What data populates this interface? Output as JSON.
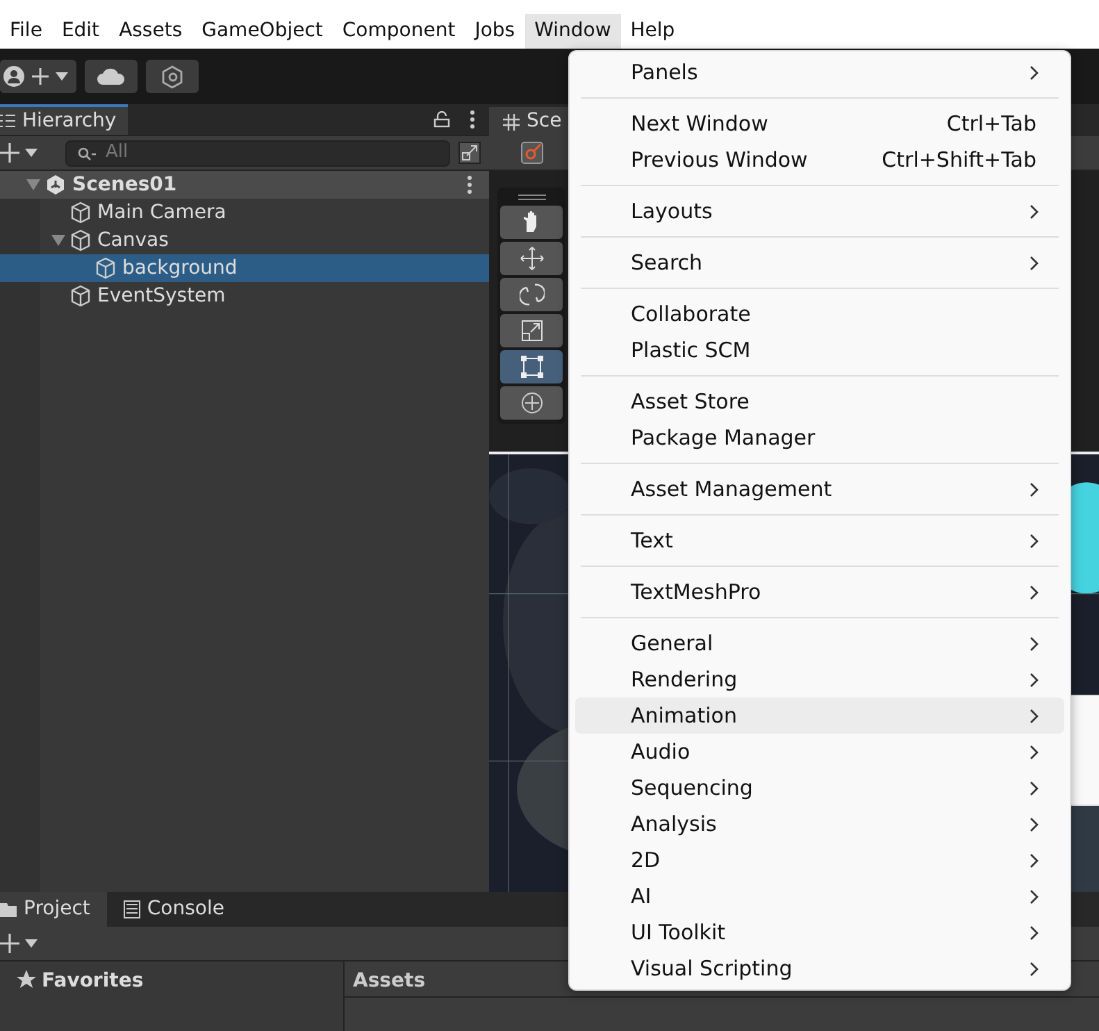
{
  "menu_bar": [
    {
      "label": "File",
      "selected": false
    },
    {
      "label": "Edit",
      "selected": false
    },
    {
      "label": "Assets",
      "selected": false
    },
    {
      "label": "GameObject",
      "selected": false
    },
    {
      "label": "Component",
      "selected": false
    },
    {
      "label": "Jobs",
      "selected": false
    },
    {
      "label": "Window",
      "selected": true
    },
    {
      "label": "Help",
      "selected": false
    }
  ],
  "hierarchy": {
    "title": "Hierarchy",
    "search": {
      "placeholder": "All"
    },
    "tree": [
      {
        "label": "Scenes01",
        "kind": "scene",
        "expanded": true,
        "selected": false,
        "children": [
          {
            "label": "Main Camera",
            "kind": "object",
            "selected": false
          },
          {
            "label": "Canvas",
            "kind": "object",
            "expanded": true,
            "selected": false,
            "children": [
              {
                "label": "background",
                "kind": "object",
                "selected": true
              }
            ]
          },
          {
            "label": "EventSystem",
            "kind": "object",
            "selected": false
          }
        ]
      }
    ]
  },
  "scene": {
    "tab": "Sce",
    "tools": [
      {
        "kind": "hand",
        "selected": false
      },
      {
        "kind": "move",
        "selected": false
      },
      {
        "kind": "rotate",
        "selected": false
      },
      {
        "kind": "scale",
        "selected": false
      },
      {
        "kind": "rect",
        "selected": true
      },
      {
        "kind": "transform",
        "selected": false
      }
    ]
  },
  "bottom": {
    "tabs": [
      {
        "label": "Project",
        "kind": "folder",
        "selected": true
      },
      {
        "label": "Console",
        "kind": "console",
        "selected": false
      }
    ],
    "favorites": "Favorites",
    "assets_header": "Assets"
  },
  "window_menu": [
    [
      {
        "label": "Panels",
        "submenu": true,
        "selected": false
      }
    ],
    [
      {
        "label": "Next Window",
        "shortcut": "Ctrl+Tab",
        "submenu": false,
        "selected": false
      },
      {
        "label": "Previous Window",
        "shortcut": "Ctrl+Shift+Tab",
        "submenu": false,
        "selected": false
      }
    ],
    [
      {
        "label": "Layouts",
        "submenu": true,
        "selected": false
      }
    ],
    [
      {
        "label": "Search",
        "submenu": true,
        "selected": false
      }
    ],
    [
      {
        "label": "Collaborate",
        "submenu": false,
        "selected": false
      },
      {
        "label": "Plastic SCM",
        "submenu": false,
        "selected": false
      }
    ],
    [
      {
        "label": "Asset Store",
        "submenu": false,
        "selected": false
      },
      {
        "label": "Package Manager",
        "submenu": false,
        "selected": false
      }
    ],
    [
      {
        "label": "Asset Management",
        "submenu": true,
        "selected": false
      }
    ],
    [
      {
        "label": "Text",
        "submenu": true,
        "selected": false
      }
    ],
    [
      {
        "label": "TextMeshPro",
        "submenu": true,
        "selected": false
      }
    ],
    [
      {
        "label": "General",
        "submenu": true,
        "selected": false
      },
      {
        "label": "Rendering",
        "submenu": true,
        "selected": false
      },
      {
        "label": "Animation",
        "submenu": true,
        "selected": true
      },
      {
        "label": "Audio",
        "submenu": true,
        "selected": false
      },
      {
        "label": "Sequencing",
        "submenu": true,
        "selected": false
      },
      {
        "label": "Analysis",
        "submenu": true,
        "selected": false
      },
      {
        "label": "2D",
        "submenu": true,
        "selected": false
      },
      {
        "label": "AI",
        "submenu": true,
        "selected": false
      },
      {
        "label": "UI Toolkit",
        "submenu": true,
        "selected": false
      },
      {
        "label": "Visual Scripting",
        "submenu": true,
        "selected": false
      }
    ]
  ]
}
